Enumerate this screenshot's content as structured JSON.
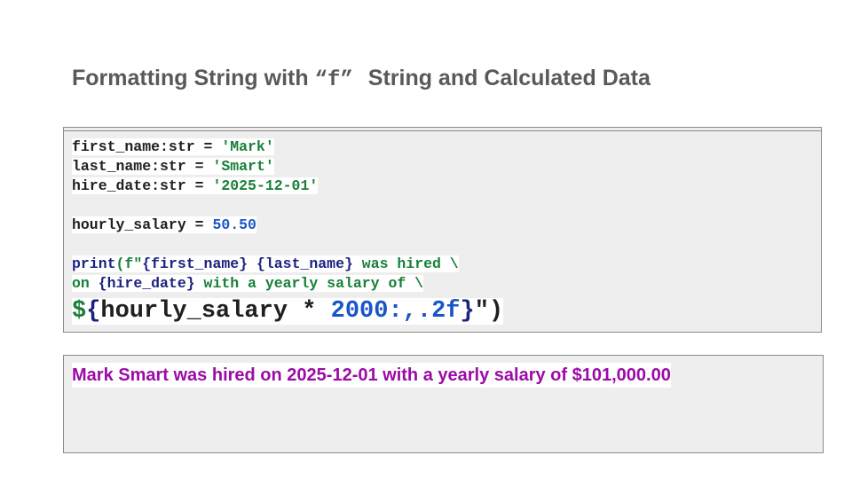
{
  "slide": {
    "title_before": "Formatting String with",
    "title_code": "“f”",
    "title_after": "String and Calculated Data"
  },
  "code": {
    "line1": {
      "var": "first_name:str = ",
      "val": "'Mark'"
    },
    "line2": {
      "var": "last_name:str = ",
      "val": "'Smart'"
    },
    "line3": {
      "var": "hire_date:str = ",
      "val": "'2025-12-01'"
    },
    "line4": {
      "var": "hourly_salary = ",
      "val": "50.50"
    },
    "line5": {
      "kw": "print",
      "p1": "(f\"",
      "b1": "{first_name}",
      "sp": " ",
      "b2": "{last_name}",
      "t": " was hired \\"
    },
    "line6": {
      "t1": "on ",
      "b": "{hire_date}",
      "t2": " with a yearly salary of \\"
    },
    "line7": {
      "t1": "$",
      "b1": "{",
      "expr": "hourly_salary * ",
      "num": "2000",
      "fmt": ":,.2f",
      "b2": "}",
      "end": "\")"
    }
  },
  "output": {
    "text": "Mark Smart was hired on 2025-12-01 with a yearly salary of $101,000.00"
  },
  "colors": {
    "string": "#188038",
    "number": "#1a55c8",
    "keyword": "#1a237e",
    "output": "#9c0aa8",
    "title": "#595959"
  }
}
